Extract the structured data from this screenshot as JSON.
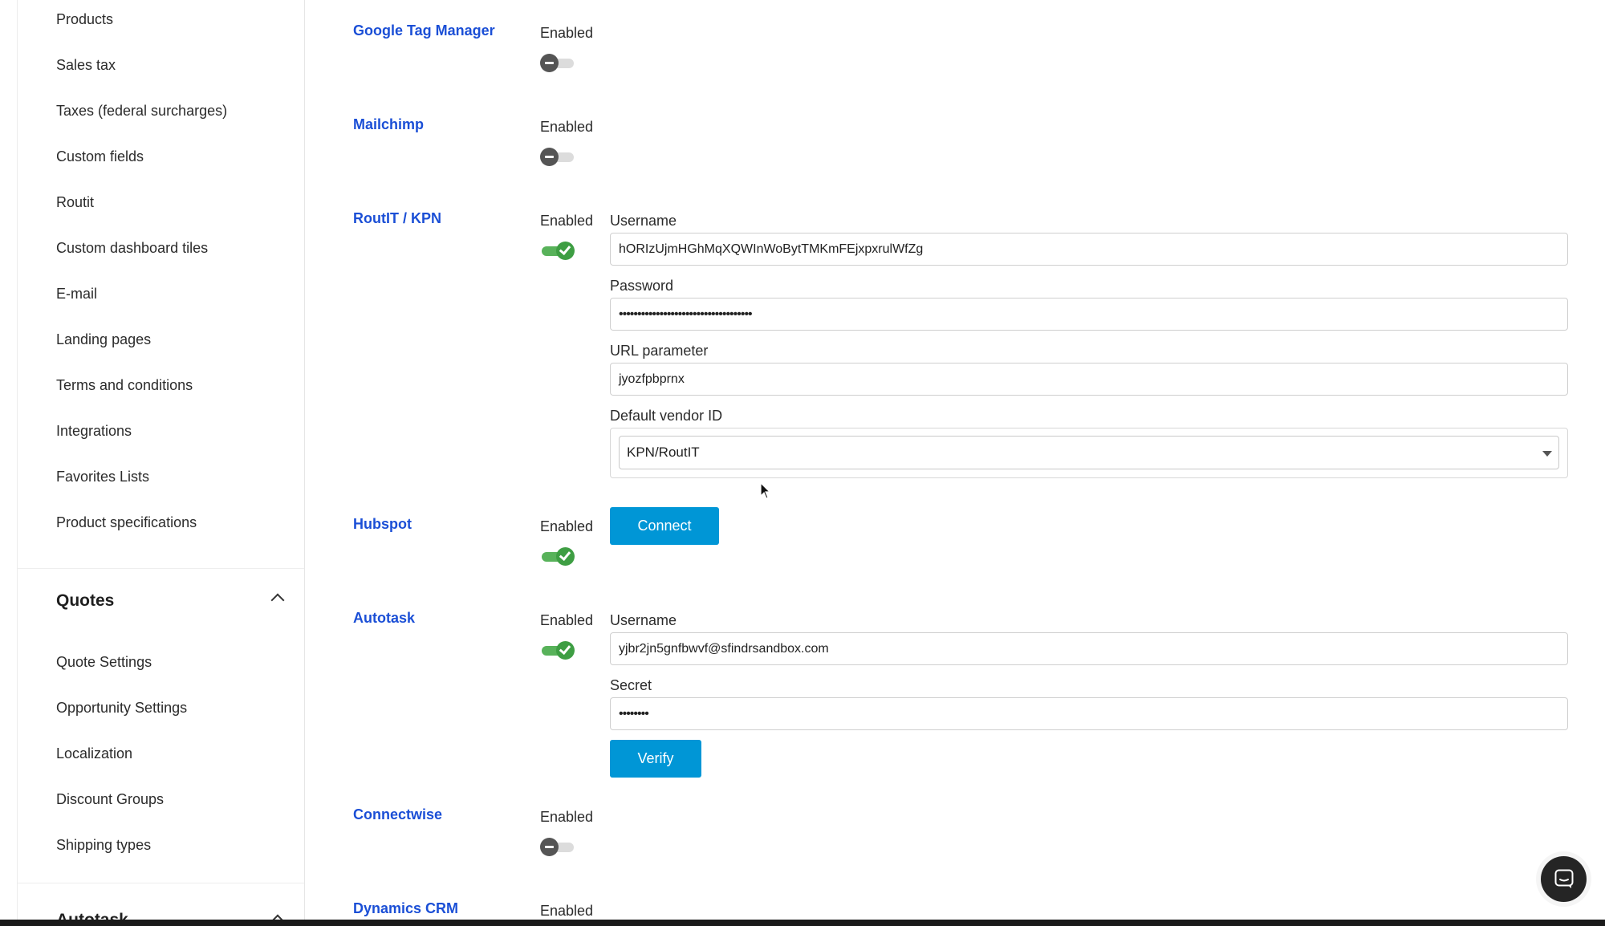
{
  "sidebar": {
    "items": [
      {
        "label": "Products"
      },
      {
        "label": "Sales tax"
      },
      {
        "label": "Taxes (federal surcharges)"
      },
      {
        "label": "Custom fields"
      },
      {
        "label": "Routit"
      },
      {
        "label": "Custom dashboard tiles"
      },
      {
        "label": "E-mail"
      },
      {
        "label": "Landing pages"
      },
      {
        "label": "Terms and conditions"
      },
      {
        "label": "Integrations"
      },
      {
        "label": "Favorites Lists"
      },
      {
        "label": "Product specifications"
      }
    ],
    "quotes_section": {
      "title": "Quotes",
      "items": [
        {
          "label": "Quote Settings"
        },
        {
          "label": "Opportunity Settings"
        },
        {
          "label": "Localization"
        },
        {
          "label": "Discount Groups"
        },
        {
          "label": "Shipping types"
        }
      ]
    },
    "next_section": {
      "title": "Autotask"
    }
  },
  "integrations": {
    "google_tag_manager": {
      "name": "Google Tag Manager",
      "enabled_label": "Enabled",
      "enabled": false
    },
    "mailchimp": {
      "name": "Mailchimp",
      "enabled_label": "Enabled",
      "enabled": false
    },
    "routit": {
      "name": "RoutIT / KPN",
      "enabled_label": "Enabled",
      "enabled": true,
      "username_label": "Username",
      "username_value": "hORIzUjmHGhMqXQWInWoBytTMKmFEjxpxrulWfZg",
      "password_label": "Password",
      "password_value": "••••••••••••••••••••••••••••••••••••",
      "url_param_label": "URL parameter",
      "url_param_value": "jyozfpbprnx",
      "vendor_label": "Default vendor ID",
      "vendor_value": "KPN/RoutIT"
    },
    "hubspot": {
      "name": "Hubspot",
      "enabled_label": "Enabled",
      "enabled": true,
      "connect_label": "Connect"
    },
    "autotask": {
      "name": "Autotask",
      "enabled_label": "Enabled",
      "enabled": true,
      "username_label": "Username",
      "username_value": "yjbr2jn5gnfbwvf@sfindrsandbox.com",
      "secret_label": "Secret",
      "secret_value": "••••••••",
      "verify_label": "Verify"
    },
    "connectwise": {
      "name": "Connectwise",
      "enabled_label": "Enabled",
      "enabled": false
    },
    "dynamics": {
      "name": "Dynamics CRM",
      "enabled_label": "Enabled"
    }
  },
  "colors": {
    "link": "#1b4fd6",
    "button": "#0096d6",
    "toggle_on": "#3e9e43",
    "toggle_off": "#555555"
  },
  "icons": {
    "chat": "chat-bubble-icon",
    "chevron": "chevron-up-icon",
    "cursor": "mouse-pointer-icon"
  }
}
